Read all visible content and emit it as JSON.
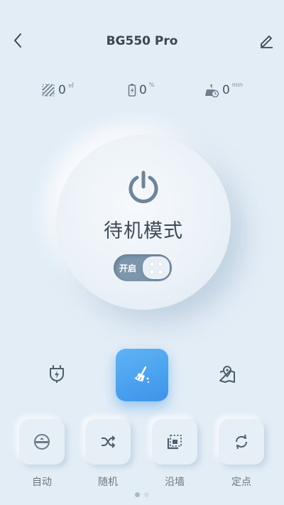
{
  "header": {
    "title": "BG550 Pro",
    "back_icon": "chevron-left-icon",
    "edit_icon": "pencil-icon"
  },
  "stats": {
    "area": {
      "icon": "area-icon",
      "value": "0",
      "unit": "㎡"
    },
    "battery": {
      "icon": "battery-icon",
      "value": "0",
      "unit": "%"
    },
    "time": {
      "icon": "clean-time-icon",
      "value": "0",
      "unit": "min"
    }
  },
  "dial": {
    "power_icon": "power-icon",
    "mode_text": "待机模式",
    "toggle_label": "开启",
    "toggle_on": true
  },
  "actions": {
    "charge_icon": "charge-dock-icon",
    "clean_icon": "broom-icon",
    "map_icon": "map-location-icon"
  },
  "modes": [
    {
      "label": "自动",
      "icon": "auto-robot-icon"
    },
    {
      "label": "随机",
      "icon": "shuffle-icon"
    },
    {
      "label": "沿墙",
      "icon": "wall-follow-icon"
    },
    {
      "label": "定点",
      "icon": "spot-refresh-icon"
    }
  ],
  "pager": {
    "pages": 2,
    "current": 1
  },
  "colors": {
    "background": "#e3edf6",
    "accent": "#3d94ea",
    "icon": "#5b6a78",
    "toggle": "#7d95ad"
  }
}
